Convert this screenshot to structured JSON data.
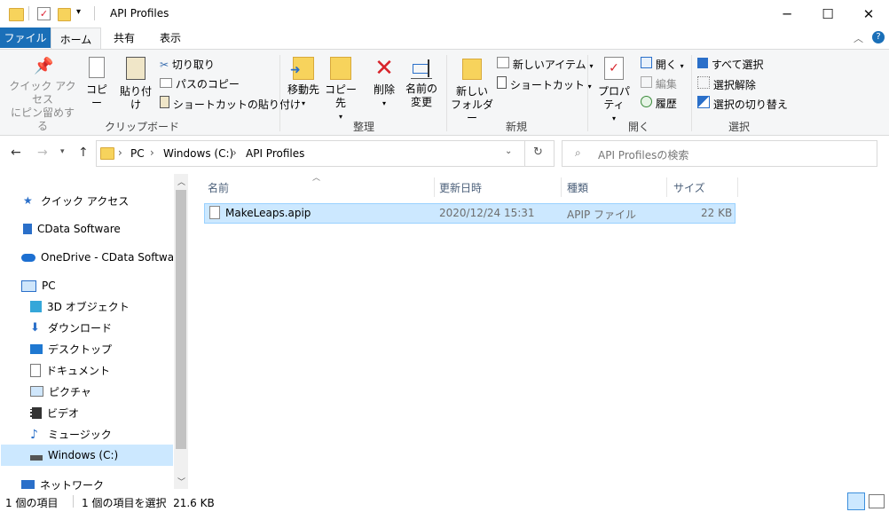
{
  "window": {
    "title": "API Profiles",
    "minimize_icon": "─",
    "maximize_icon": "☐",
    "close_icon": "✕"
  },
  "ribbon_tabs": [
    "ファイル",
    "ホーム",
    "共有",
    "表示"
  ],
  "ribbon": {
    "clipboard": {
      "pin_label_1": "クイック アクセス",
      "pin_label_2": "にピン留めする",
      "copy": "コピー",
      "paste": "貼り付け",
      "cut": "切り取り",
      "copy_path": "パスのコピー",
      "paste_shortcut": "ショートカットの貼り付け",
      "group": "クリップボード"
    },
    "organize": {
      "move_to": "移動先",
      "copy_to": "コピー先",
      "delete": "削除",
      "rename_1": "名前の",
      "rename_2": "変更",
      "group": "整理"
    },
    "new": {
      "new_folder_1": "新しい",
      "new_folder_2": "フォルダー",
      "new_item": "新しいアイテム",
      "shortcut": "ショートカット",
      "group": "新規"
    },
    "open": {
      "properties": "プロパティ",
      "open": "開く",
      "edit": "編集",
      "history": "履歴",
      "group": "開く"
    },
    "select": {
      "select_all": "すべて選択",
      "select_none": "選択解除",
      "invert": "選択の切り替え",
      "group": "選択"
    }
  },
  "address": {
    "crumbs": [
      "PC",
      "Windows (C:)",
      "API Profiles"
    ],
    "search_placeholder": "API Profilesの検索"
  },
  "nav": {
    "quick_access": "クイック アクセス",
    "cdata": "CData Software",
    "onedrive": "OneDrive - CData Software",
    "pc": "PC",
    "objects3d": "3D オブジェクト",
    "downloads": "ダウンロード",
    "desktop": "デスクトップ",
    "documents": "ドキュメント",
    "pictures": "ピクチャ",
    "videos": "ビデオ",
    "music": "ミュージック",
    "windows_c": "Windows (C:)",
    "network": "ネットワーク"
  },
  "list": {
    "columns": [
      "名前",
      "更新日時",
      "種類",
      "サイズ"
    ],
    "rows": [
      {
        "name": "MakeLeaps.apip",
        "date": "2020/12/24 15:31",
        "type": "APIP ファイル",
        "size": "22 KB"
      }
    ]
  },
  "status": {
    "items": "1 個の項目",
    "selected": "1 個の項目を選択  21.6 KB"
  },
  "colors": {
    "file_tab": "#1a6fb8",
    "selection": "#cce8ff",
    "folder": "#f7d35c"
  }
}
